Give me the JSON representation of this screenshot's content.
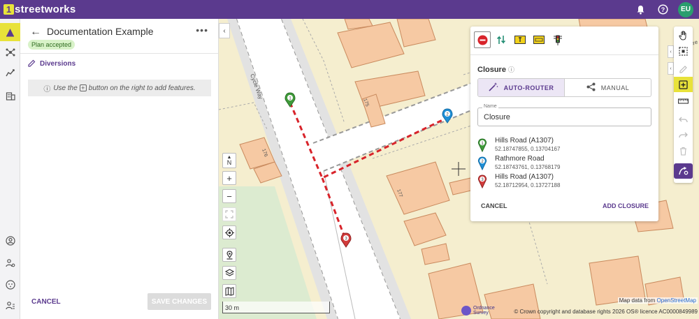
{
  "app": {
    "logo_mark": "1",
    "logo_text": "streetworks",
    "user_initials": "EU"
  },
  "topbar": {
    "icons": [
      "bell-icon",
      "help-icon"
    ]
  },
  "rail": {
    "icons": [
      "roadworks-icon",
      "network-icon",
      "analytics-icon",
      "buildings-icon",
      "account-icon",
      "admin-icon",
      "support-icon",
      "team-settings-icon"
    ]
  },
  "panel": {
    "title": "Documentation Example",
    "status": "Plan accepted",
    "section": "Diversions",
    "hint_prefix": "Use the",
    "hint_suffix": "button on the right to add features.",
    "cancel": "CANCEL",
    "save": "SAVE CHANGES"
  },
  "map": {
    "compass": "N",
    "zoom_in": "+",
    "zoom_out": "−",
    "scale": "30 m",
    "attribution_prefix": "Map data from",
    "attribution_link": "OpenStreetMap",
    "os_logo": "Ordnance Survey",
    "copyright": "© Crown copyright and database rights 2026 OS® licence AC0000849989",
    "labels": {
      "street": "Cycle Way",
      "house_175": "175",
      "house_177": "177",
      "house_176": "176",
      "street_corner": "ore"
    },
    "pins": [
      "1",
      "2",
      "3"
    ]
  },
  "closure": {
    "title": "Closure",
    "mode_auto": "AUTO-ROUTER",
    "mode_manual": "MANUAL",
    "name_label": "Name",
    "name_value": "Closure",
    "waypoints": [
      {
        "num": "1",
        "name": "Hills Road (A1307)",
        "coords": "52.18747855, 0.13704167",
        "color": "#3f9b3a"
      },
      {
        "num": "2",
        "name": "Rathmore Road",
        "coords": "52.18743761, 0.13768179",
        "color": "#1f8fd6"
      },
      {
        "num": "3",
        "name": "Hills Road (A1307)",
        "coords": "52.18712954, 0.13727188",
        "color": "#d23b3b"
      }
    ],
    "cancel": "CANCEL",
    "add": "ADD CLOSURE"
  },
  "colors": {
    "brand": "#5b3a8e",
    "accent": "#e8e23a",
    "closure_route": "#d8232a"
  }
}
